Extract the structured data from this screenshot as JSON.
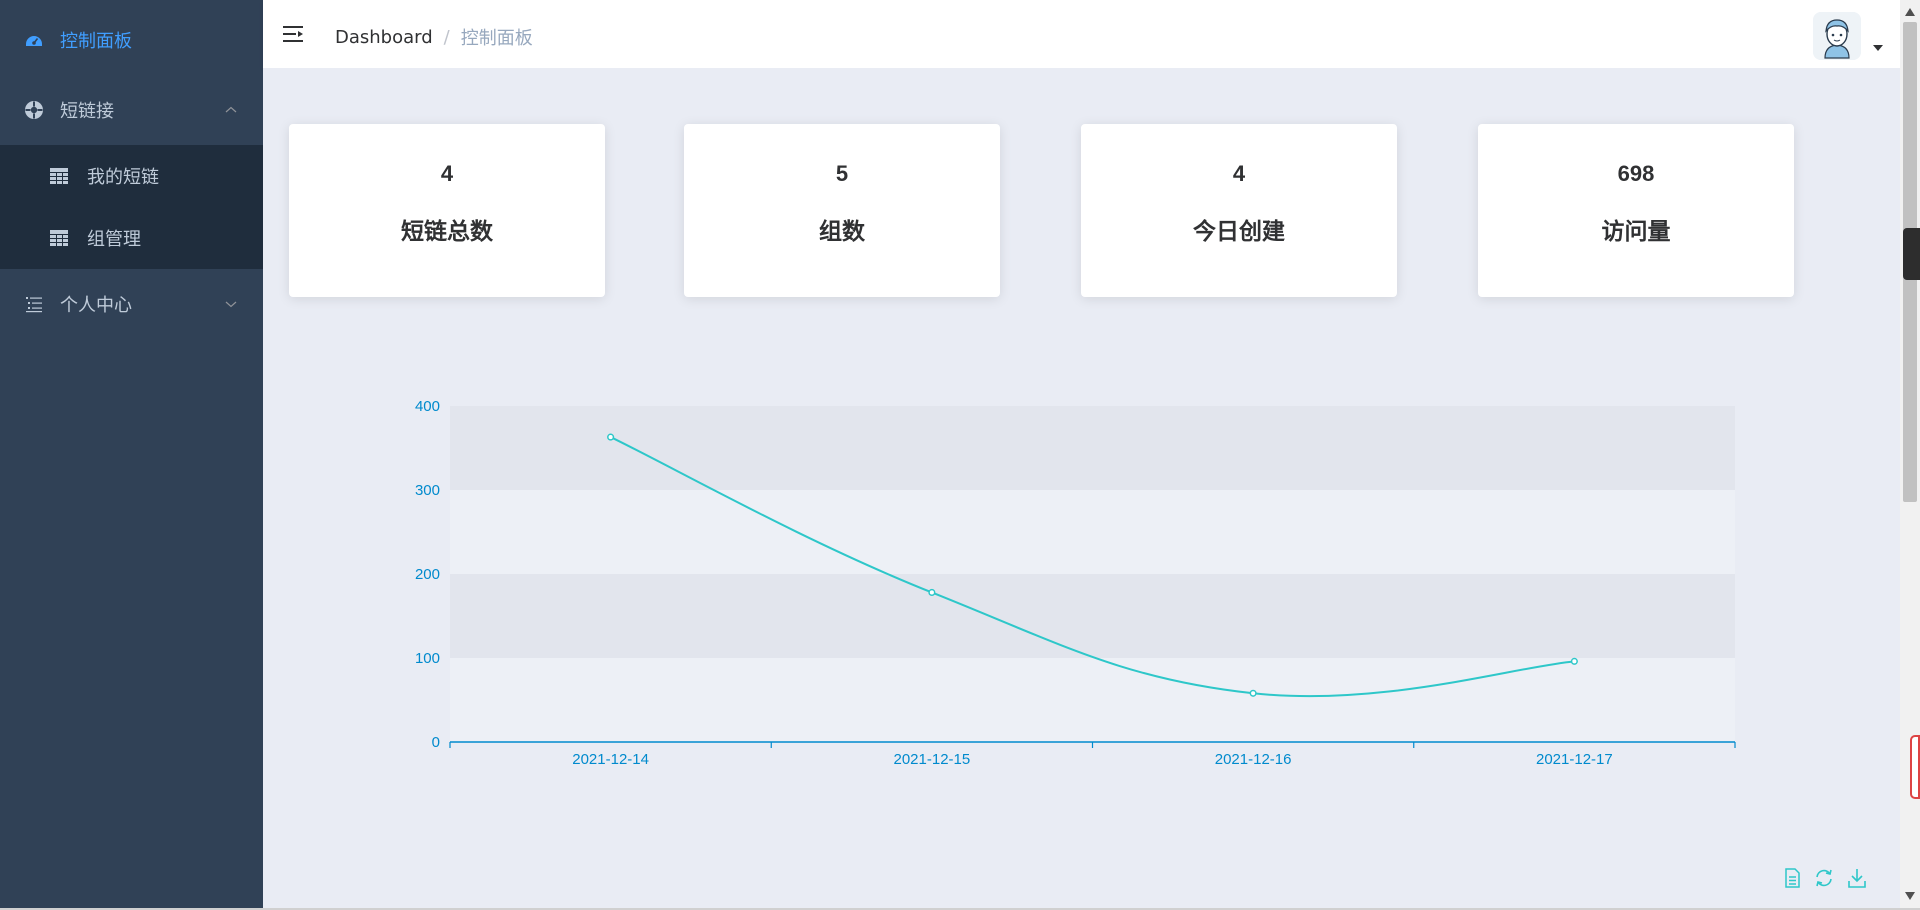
{
  "sidebar": {
    "items": [
      {
        "label": "控制面板",
        "icon": "dashboard-icon",
        "active": true
      },
      {
        "label": "短链接",
        "icon": "link-circle-icon",
        "expanded": true,
        "children": [
          {
            "label": "我的短链",
            "icon": "table-icon"
          },
          {
            "label": "组管理",
            "icon": "table-icon"
          }
        ]
      },
      {
        "label": "个人中心",
        "icon": "list-icon",
        "expanded": false
      }
    ]
  },
  "header": {
    "breadcrumb": [
      "Dashboard",
      "控制面板"
    ],
    "breadcrumb_separator": "/"
  },
  "stats": [
    {
      "value": "4",
      "label": "短链总数"
    },
    {
      "value": "5",
      "label": "组数"
    },
    {
      "value": "4",
      "label": "今日创建"
    },
    {
      "value": "698",
      "label": "访问量"
    }
  ],
  "chart_data": {
    "type": "line",
    "categories": [
      "2021-12-14",
      "2021-12-15",
      "2021-12-16",
      "2021-12-17"
    ],
    "series": [
      {
        "values": [
          363,
          178,
          58,
          96
        ]
      }
    ],
    "y_ticks": [
      0,
      100,
      200,
      300,
      400
    ],
    "ylim": [
      0,
      400
    ],
    "smooth": true,
    "grid": "alternating-bands",
    "line_color": "#2ec7c9",
    "axis_color": "#008acd"
  },
  "toolbox": [
    "data-view-icon",
    "restore-icon",
    "save-image-icon"
  ],
  "colors": {
    "sidebar_bg": "#304156",
    "submenu_bg": "#1f2d3d",
    "active": "#409eff",
    "main_bg": "#e9ecf4"
  }
}
